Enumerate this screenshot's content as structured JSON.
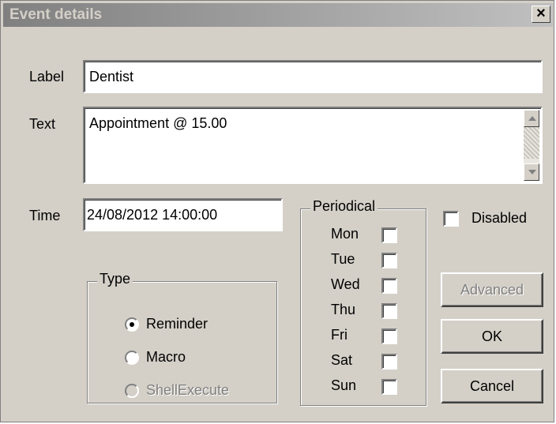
{
  "window": {
    "title": "Event details",
    "close_glyph": "✕"
  },
  "form": {
    "label_caption": "Label",
    "label_value": "Dentist",
    "text_caption": "Text",
    "text_value": "Appointment @ 15.00",
    "time_caption": "Time",
    "time_value": "24/08/2012 14:00:00"
  },
  "periodical": {
    "title": "Periodical",
    "days": [
      {
        "name": "Mon",
        "checked": false
      },
      {
        "name": "Tue",
        "checked": false
      },
      {
        "name": "Wed",
        "checked": false
      },
      {
        "name": "Thu",
        "checked": false
      },
      {
        "name": "Fri",
        "checked": false
      },
      {
        "name": "Sat",
        "checked": false
      },
      {
        "name": "Sun",
        "checked": false
      }
    ]
  },
  "type": {
    "title": "Type",
    "options": [
      {
        "label": "Reminder",
        "selected": true,
        "enabled": true
      },
      {
        "label": "Macro",
        "selected": false,
        "enabled": true
      },
      {
        "label": "ShellExecute",
        "selected": false,
        "enabled": false
      }
    ]
  },
  "disabled_label": "Disabled",
  "buttons": {
    "advanced": "Advanced",
    "ok": "OK",
    "cancel": "Cancel"
  }
}
